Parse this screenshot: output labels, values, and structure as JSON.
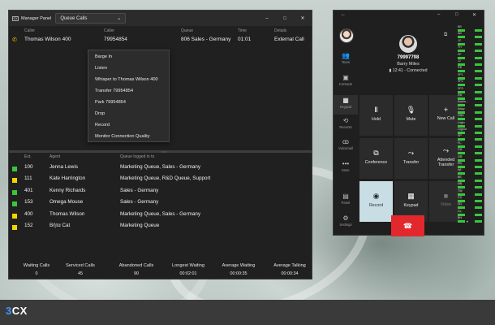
{
  "manager_panel": {
    "app_title": "Manager Panel",
    "app_icon_text": "OX",
    "queue_select": "Queue Calls",
    "window_buttons": [
      "–",
      "□",
      "✕"
    ],
    "calls_columns": [
      "Caller",
      "Caller",
      "Queue",
      "Time",
      "Details"
    ],
    "call_row": {
      "caller": "Thomas Wilson 400",
      "caller_number": "79954854",
      "queue": "806 Sales - Germany",
      "time": "01:01",
      "details": "External Call"
    },
    "context_menu": [
      "Barge In",
      "Listen",
      "Whisper to Thomas Wilson 400",
      "Transfer 79954854",
      "Park 79954854",
      "Drop",
      "Record",
      "Monitor Connection Quality"
    ],
    "agents_columns": [
      "Ext.",
      "Agent",
      "Queue logged in to"
    ],
    "agents": [
      {
        "ext": "100",
        "agent": "Jenna Lewis",
        "queues": "Marketing Queue, Sales - Germany",
        "status_color": "#3cc43c"
      },
      {
        "ext": "111",
        "agent": "Kate Harrington",
        "queues": "Marketing Queue, R&D Queue, Support",
        "status_color": "#f2d400"
      },
      {
        "ext": "401",
        "agent": "Kenny Richards",
        "queues": "Sales - Germany",
        "status_color": "#3cc43c"
      },
      {
        "ext": "153",
        "agent": "Omega Mouse",
        "queues": "Sales - Germany",
        "status_color": "#3cc43c"
      },
      {
        "ext": "400",
        "agent": "Thomas Wilson",
        "queues": "Marketing Queue, Sales - Germany",
        "status_color": "#f2d400"
      },
      {
        "ext": "152",
        "agent": "Βήτα Cat",
        "queues": "Marketing Queue",
        "status_color": "#f2d400"
      }
    ],
    "stats": [
      {
        "label": "Waiting Calls",
        "value": "0"
      },
      {
        "label": "Serviced Calls",
        "value": "45"
      },
      {
        "label": "Abandoned Calls",
        "value": "90"
      },
      {
        "label": "Longest Waiting",
        "value": "00:02:01"
      },
      {
        "label": "Average Waiting",
        "value": "00:00:35"
      },
      {
        "label": "Average Talking",
        "value": "00:00:34"
      }
    ]
  },
  "web_client": {
    "back_icon": "←",
    "window_buttons": [
      "–",
      "□",
      "✕"
    ],
    "nav": [
      {
        "label": "Team",
        "icon": "people-icon"
      },
      {
        "label": "Contacts",
        "icon": "contacts-icon"
      },
      {
        "label": "Keypad",
        "icon": "keypad-icon"
      },
      {
        "label": "Recents",
        "icon": "recents-icon"
      },
      {
        "label": "Voicemail",
        "icon": "voicemail-icon"
      },
      {
        "label": "More",
        "icon": "more-icon"
      },
      {
        "label": "Panel",
        "icon": "panel-icon"
      },
      {
        "label": "Settings",
        "icon": "settings-icon"
      }
    ],
    "caller": {
      "number": "79997798",
      "name": "Barry Miles",
      "status": "12:41 - Connected"
    },
    "buttons": [
      {
        "label": "Hold",
        "icon": "Ⅱ"
      },
      {
        "label": "Mute",
        "icon": "🎙"
      },
      {
        "label": "New Call",
        "icon": "+"
      },
      {
        "label": "Conference",
        "icon": "⧉"
      },
      {
        "label": "Transfer",
        "icon": "⤳"
      },
      {
        "label": "Attended Transfer",
        "icon": "⤳"
      },
      {
        "label": "Record",
        "icon": "◉"
      },
      {
        "label": "Keypad",
        "icon": "▦"
      },
      {
        "label": "Video",
        "icon": "■"
      }
    ],
    "blf_labels": [
      "BB",
      "AB",
      "JC",
      "TH",
      "SF",
      "JJ",
      "RB",
      "SP1",
      "SP2",
      "SP3",
      "RB",
      "Availa...",
      "Away",
      "DND",
      "Login",
      "Logout",
      "SP",
      "FL",
      "CH",
      "GR",
      "EB",
      "WI",
      "BE",
      "NB",
      "TW",
      "CC",
      "SD",
      "CL",
      "BH"
    ],
    "more_dots": "• •"
  },
  "taskbar": {
    "logo_digit": "3",
    "logo_text": "CX"
  }
}
